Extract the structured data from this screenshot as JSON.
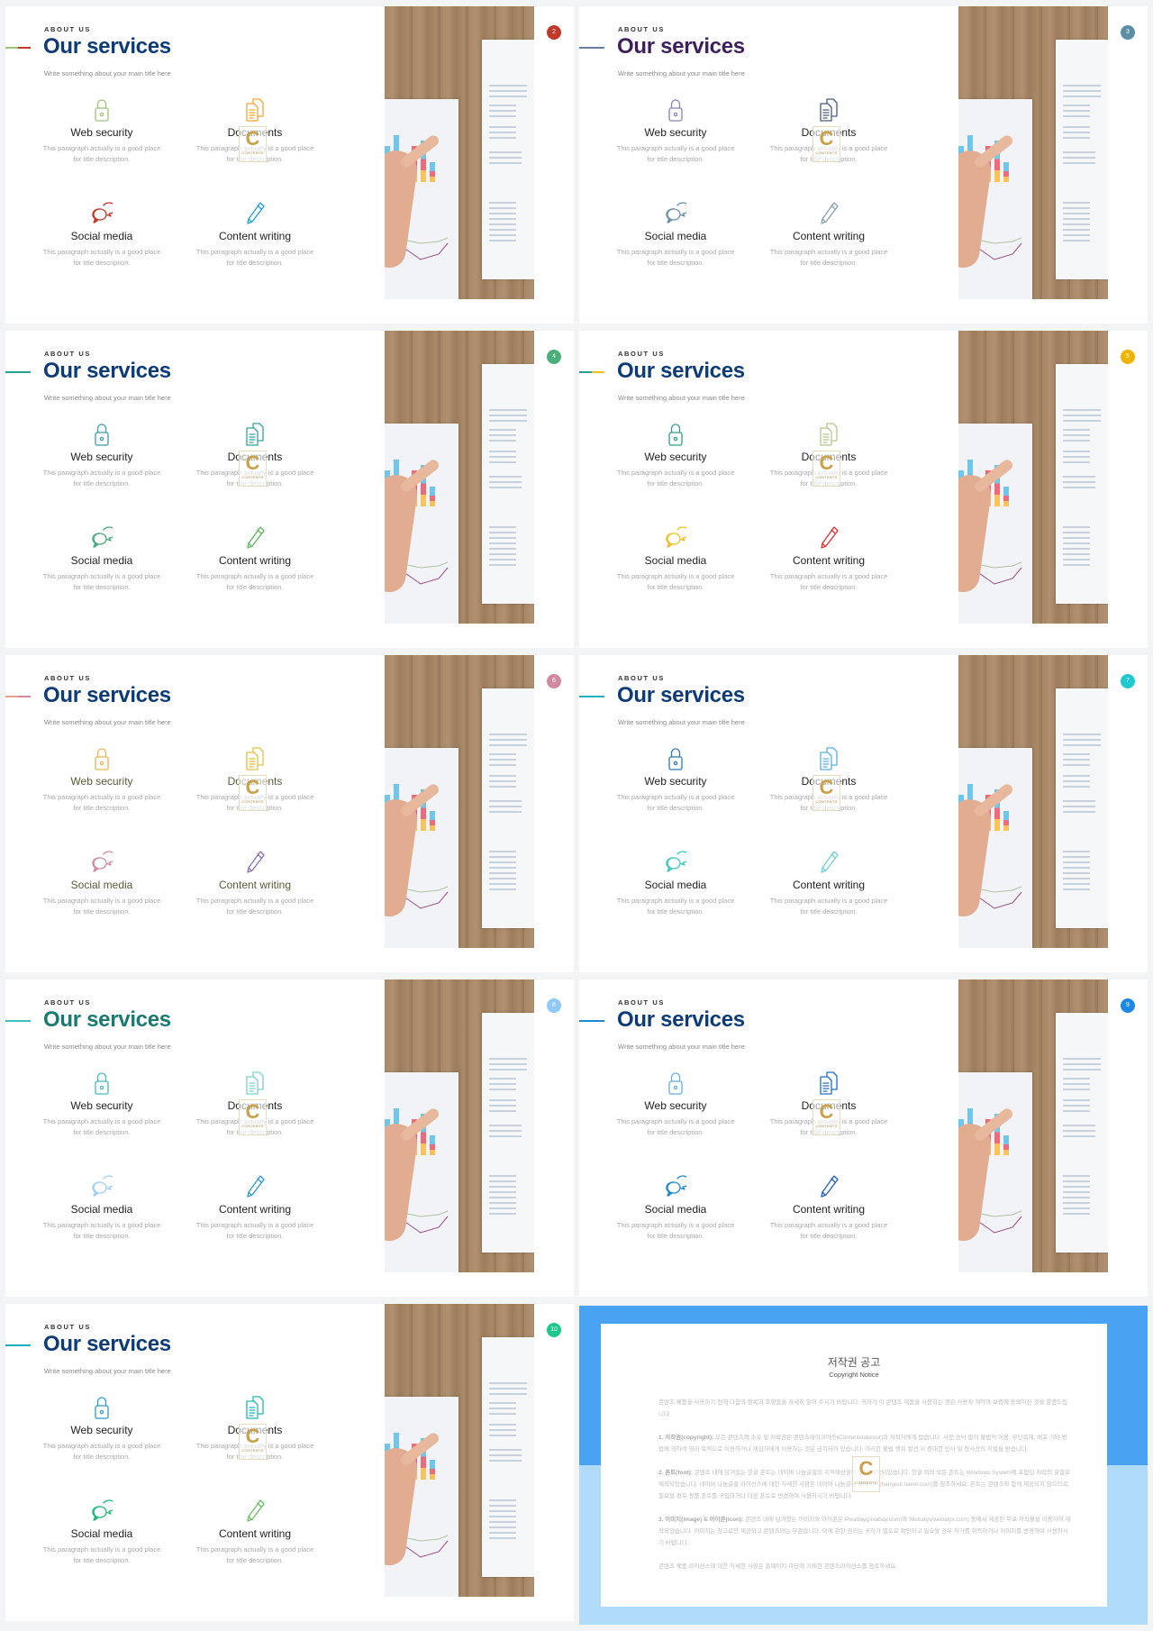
{
  "common": {
    "eyebrow": "ABOUT US",
    "title": "Our services",
    "subtitle": "Write something about your main title here",
    "services": [
      {
        "icon": "lock-icon",
        "label": "Web security",
        "desc1": "This paragraph actually is a good place",
        "desc2": "for title description."
      },
      {
        "icon": "documents-icon",
        "label": "Documents",
        "desc1": "This paragraph actually is a good place",
        "desc2": "for title description."
      },
      {
        "icon": "chat-bubbles-icon",
        "label": "Social media",
        "desc1": "This paragraph actually is a good place",
        "desc2": "for title description."
      },
      {
        "icon": "pencil-icon",
        "label": "Content writing",
        "desc1": "This paragraph actually is a good place",
        "desc2": "for title description."
      }
    ],
    "watermark": "CONTENTS"
  },
  "slides": [
    {
      "badge": "2",
      "badge_color": "#c0392b",
      "title_color": "#0d3b78",
      "accent": [
        "#9bc47a",
        "#c0392b"
      ],
      "icon_colors": [
        "#9bc47a",
        "#f0a830",
        "#c0392b",
        "#1e9fd8"
      ]
    },
    {
      "badge": "3",
      "badge_color": "#5b8fa8",
      "title_color": "#3d1f5c",
      "accent": [
        "#6b7fa0"
      ],
      "icon_colors": [
        "#8a7fb8",
        "#4a5a7a",
        "#6a8fa8",
        "#8aa0b0"
      ]
    },
    {
      "badge": "4",
      "badge_color": "#4caf7a",
      "title_color": "#0d3b78",
      "accent": [
        "#2aa198"
      ],
      "icon_colors": [
        "#3a9ab0",
        "#3aa0a0",
        "#4aa87a",
        "#5cb85c"
      ]
    },
    {
      "badge": "5",
      "badge_color": "#f0b400",
      "title_color": "#0d3b78",
      "accent": [
        "#2aa198",
        "#f0c020"
      ],
      "icon_colors": [
        "#2e9e8a",
        "#b5c88a",
        "#f0c020",
        "#e03030"
      ]
    },
    {
      "badge": "6",
      "badge_color": "#d08aa0",
      "title_color": "#0d3b78",
      "accent": [
        "#e8a090",
        "#d08aa0"
      ],
      "icon_colors": [
        "#f0b050",
        "#e0c040",
        "#d08aa0",
        "#8a70b0"
      ],
      "label_color": "#5a5a3a"
    },
    {
      "badge": "7",
      "badge_color": "#20c8d0",
      "title_color": "#0d3b78",
      "accent": [
        "#20b0c0"
      ],
      "icon_colors": [
        "#2a7ab8",
        "#5ab0e0",
        "#3cc8c0",
        "#70d0d8"
      ]
    },
    {
      "badge": "8",
      "badge_color": "#90c8f8",
      "title_color": "#1a7a70",
      "accent": [
        "#40c0c0"
      ],
      "icon_colors": [
        "#40b8c0",
        "#80d0d0",
        "#a0d0f0",
        "#2a9ad0"
      ]
    },
    {
      "badge": "9",
      "badge_color": "#1e88e5",
      "title_color": "#0d3b78",
      "accent": [
        "#1e88d0"
      ],
      "icon_colors": [
        "#60b0e0",
        "#1e70c0",
        "#1e88c8",
        "#2060b0"
      ]
    },
    {
      "badge": "10",
      "badge_color": "#1ec88a",
      "title_color": "#0d3b78",
      "accent": [
        "#1eb0c0"
      ],
      "icon_colors": [
        "#2a9ad0",
        "#20b8b0",
        "#20b87a",
        "#6ac060"
      ]
    }
  ],
  "copyright": {
    "title": "저작권 공고",
    "subtitle": "Copyright Notice",
    "intro": "콘텐츠 제품을 사용하기 전에 다음의 항목과 조항들을 자세히 읽어 주시기 바랍니다. 귀하가 이 콘텐츠 제품을 사용하는 것은 사용자 계약과 보증에 동의하신 것을 말씀드립니다.",
    "items": [
      {
        "head": "1. 저작권(copyright):",
        "text": " 모든 콘텐츠의 소유 및 저작권은 콘텐츠레이크아웃(Contentslakeout)의 저작자에게 있습니다. 사전 승낙 없이 불법적 이용, 무단복제, 배포 기타 방법에 의하여 영리 목적으로 이용하거나 제삼자에게 이용하는 것은 금지되어 있습니다. 이러한 불법 행위 발견 시 중대한 민사 및 형사상의 처벌을 받습니다."
      },
      {
        "head": "2. 폰트(font):",
        "text": " 콘텐츠 내에 담겨있는 한글 폰트는 네이버 나눔글꼴의 지적재산권이 있어 제작되었습니다. 한글 외의 모든 폰트는 Windows System에 포함된 저작의 글꼴로 제작되었습니다. 네이버 나눔글꼴 라이선스에 대한 자세한 사항은 네이버 나눔글꼴 홈페이지(hangeul.naver.com)를 참조하세요. 폰트는 콘텐츠와 함께 제공되지 않으므로, 필요할 경우 정품 폰트를 구입하거나 다른 폰트로 변경하여 사용하시기 바랍니다."
      },
      {
        "head": "3. 이미지(image) & 아이콘(icon):",
        "text": " 콘텐츠 내에 담겨있는 이미지와 아이콘은 Pixabay(pixabay.com)와 Webalys(webalys.com) 등에서 제공한 무료 저작물을 이용하여 제작되었습니다. 이미지는 참고로만 제공되고 콘텐츠와는 무관합니다. 이에 관한 권리는 귀하가 별도로 확인하고 필요할 경우 허가를 취득하거나 이미지를 변경하여 사용하시기 바랍니다."
      }
    ],
    "outro": "콘텐츠 제품 라이선스에 대한 자세한 사항은 홈페이지 하단에 기재한 콘텐츠라이선스를 참조하세요.",
    "bg_top": "#4aa3f2",
    "bg_bottom": "#b0dcfa"
  }
}
